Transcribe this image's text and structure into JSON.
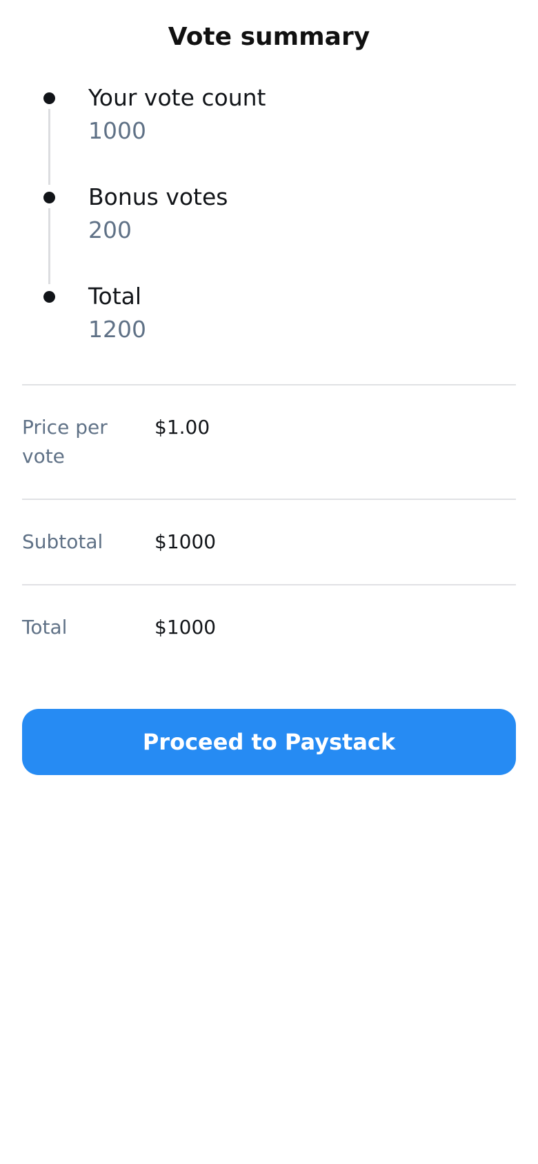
{
  "page": {
    "title": "Vote summary"
  },
  "timeline": {
    "items": [
      {
        "label": "Your vote count",
        "value": "1000"
      },
      {
        "label": "Bonus votes",
        "value": "200"
      },
      {
        "label": "Total",
        "value": "1200"
      }
    ]
  },
  "summary": {
    "rows": [
      {
        "label": "Price per vote",
        "value": "$1.00"
      },
      {
        "label": "Subtotal",
        "value": "$1000"
      },
      {
        "label": "Total",
        "value": "$1000"
      }
    ]
  },
  "actions": {
    "proceed_label": "Proceed to Paystack"
  },
  "colors": {
    "accent": "#268bf3",
    "muted_text": "#5f7186",
    "primary_text": "#111418",
    "divider": "#e0e1e4"
  }
}
